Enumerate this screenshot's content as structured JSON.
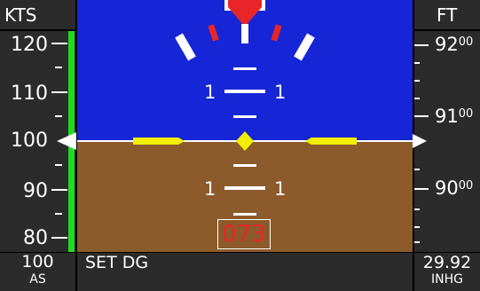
{
  "airspeed": {
    "unit_label": "KTS",
    "scale_labels": [
      "120",
      "110",
      "100",
      "90",
      "80"
    ],
    "current_value": "100",
    "current_label": "AS",
    "green_band_color": "#1fdc1f"
  },
  "altitude": {
    "unit_label": "FT",
    "scale_labels": [
      {
        "big": "92",
        "small": "00"
      },
      {
        "big": "91",
        "small": "00"
      },
      {
        "big": "90",
        "small": "00"
      }
    ]
  },
  "attitude": {
    "sky_color": "#1626d6",
    "ground_color": "#8c5a2b",
    "pitch_labels": [
      "1",
      "1",
      "1",
      "1"
    ],
    "aircraft_symbol_color": "#f2ee00",
    "bank_pointer_color": "#e8262a"
  },
  "heading": {
    "value": "073"
  },
  "footer": {
    "message": "SET DG",
    "baro_value": "29.92",
    "baro_unit": "INHG"
  }
}
